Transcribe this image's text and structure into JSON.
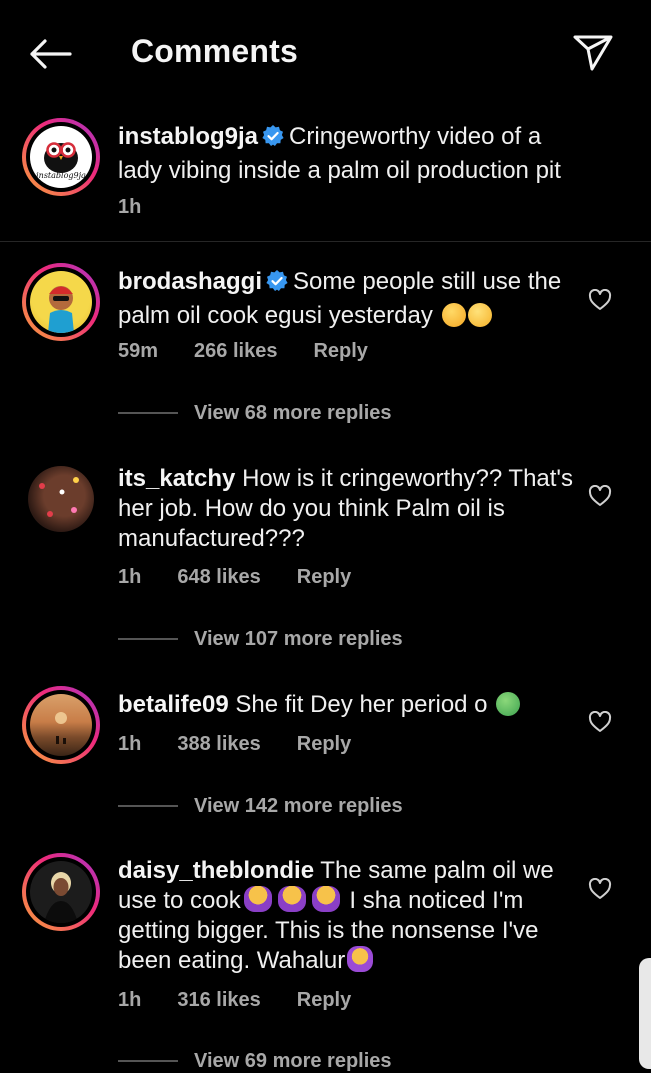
{
  "header": {
    "title": "Comments",
    "back_icon": "arrow-left-icon",
    "share_icon": "paper-plane-icon"
  },
  "caption": {
    "username": "instablog9ja",
    "verified": true,
    "text": "Cringeworthy video of a lady vibing inside a palm oil production pit",
    "time": "1h",
    "avatar_text": "instablog9ja"
  },
  "comments": [
    {
      "username": "brodashaggi",
      "verified": true,
      "text": "Some people still use the palm oil cook egusi yesterday",
      "emojis": [
        "weary-face",
        "tears-of-joy"
      ],
      "time": "59m",
      "likes": "266 likes",
      "reply": "Reply",
      "view_replies": "View 68 more replies"
    },
    {
      "username": "its_katchy",
      "verified": false,
      "text": "How is it cringeworthy?? That's her job. How do you think Palm oil is manufactured???",
      "time": "1h",
      "likes": "648 likes",
      "reply": "Reply",
      "view_replies": "View 107 more replies"
    },
    {
      "username": "betalife09",
      "verified": false,
      "text": "She fit Dey her period o",
      "emojis": [
        "nauseated-face"
      ],
      "time": "1h",
      "likes": "388 likes",
      "reply": "Reply",
      "view_replies": "View 142 more replies"
    },
    {
      "username": "daisy_theblondie",
      "verified": false,
      "text_1": "The same palm oil we use to cook",
      "text_2": "I sha noticed I'm getting bigger. This is the nonsense I've been eating. Wahalur",
      "emojis": [
        "woman-facepalming",
        "woman-facepalming",
        "woman-facepalming",
        "woman-frowning"
      ],
      "time": "1h",
      "likes": "316 likes",
      "reply": "Reply",
      "view_replies": "View 69 more replies"
    }
  ],
  "colors": {
    "background": "#000000",
    "text_primary": "#f5f5f5",
    "text_secondary": "#a8a8a8",
    "verified_blue": "#3897f0",
    "story_ring_start": "#f9a33a",
    "story_ring_end": "#a334c9"
  }
}
